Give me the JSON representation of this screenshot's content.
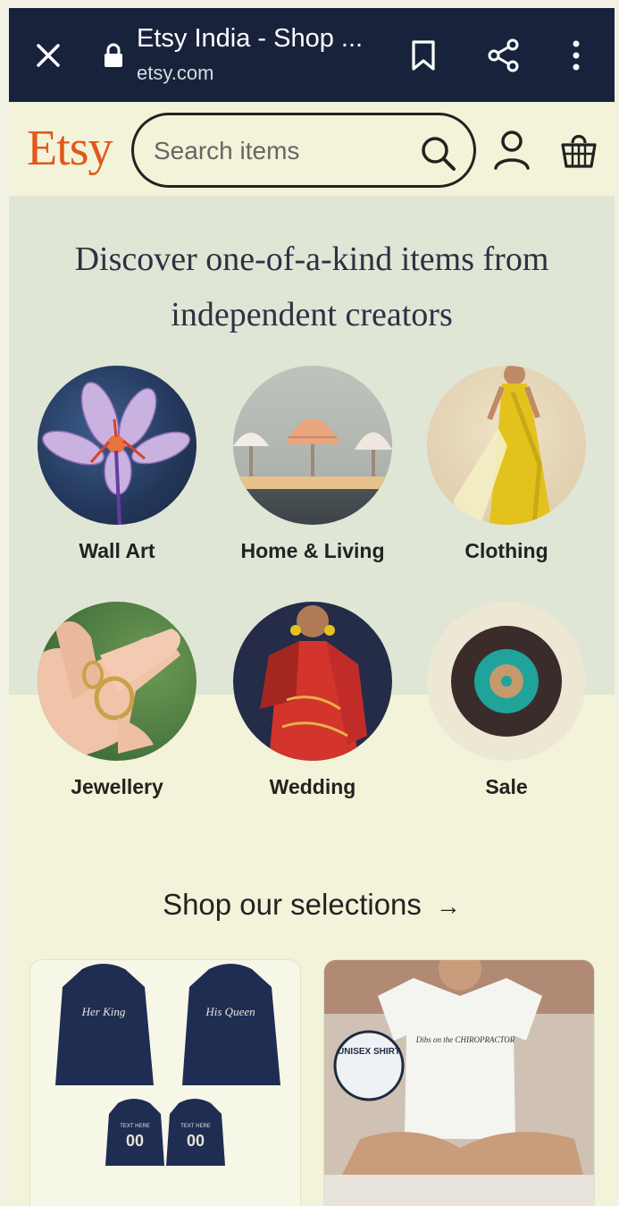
{
  "browser": {
    "tab_title": "Etsy India - Shop ...",
    "domain": "etsy.com"
  },
  "header": {
    "logo": "Etsy",
    "search_placeholder": "Search items"
  },
  "hero": {
    "heading": "Discover one-of-a-kind items from independent creators"
  },
  "categories": [
    {
      "label": "Wall Art"
    },
    {
      "label": "Home & Living"
    },
    {
      "label": "Clothing"
    },
    {
      "label": "Jewellery"
    },
    {
      "label": "Wedding"
    },
    {
      "label": "Sale"
    }
  ],
  "selections": {
    "title": "Shop our selections",
    "arrow": "→",
    "card1": {
      "hoodie1": "Her King",
      "hoodie2": "His Queen",
      "small1": "00",
      "small2": "00",
      "text_here": "TEXT HERE"
    },
    "card2": {
      "badge": "UNISEX SHIRT",
      "shirt_text": "Dibs on the CHIROPRACTOR"
    }
  },
  "colors": {
    "brand": "#e2571c",
    "chrome": "#18233b",
    "hero_bg": "#dfe6d6",
    "page_bg": "#f3f3d9"
  }
}
